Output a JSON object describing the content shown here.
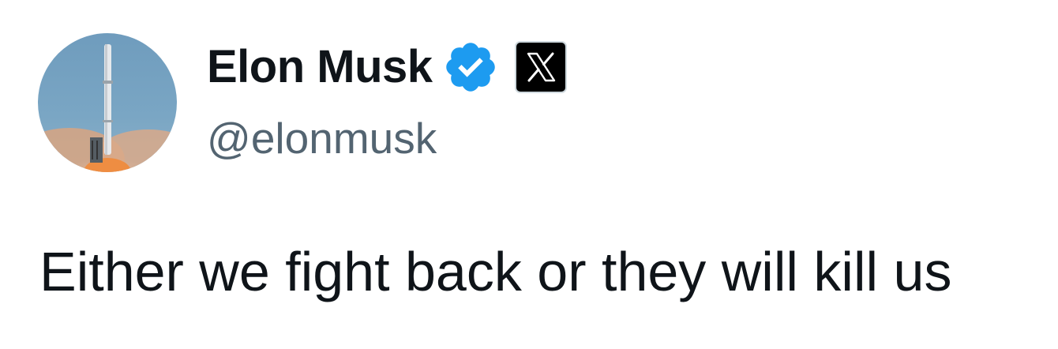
{
  "author": {
    "display_name": "Elon Musk",
    "handle": "@elonmusk",
    "avatar_icon": "rocket-launch-avatar",
    "verified_icon": "verified-badge-icon",
    "affiliation_icon": "x-logo-icon"
  },
  "tweet": {
    "text": "Either we fight back or they will kill us"
  },
  "colors": {
    "text_primary": "#0f1419",
    "text_secondary": "#536471",
    "verified_blue": "#1d9bf0",
    "affiliate_bg": "#000000"
  }
}
